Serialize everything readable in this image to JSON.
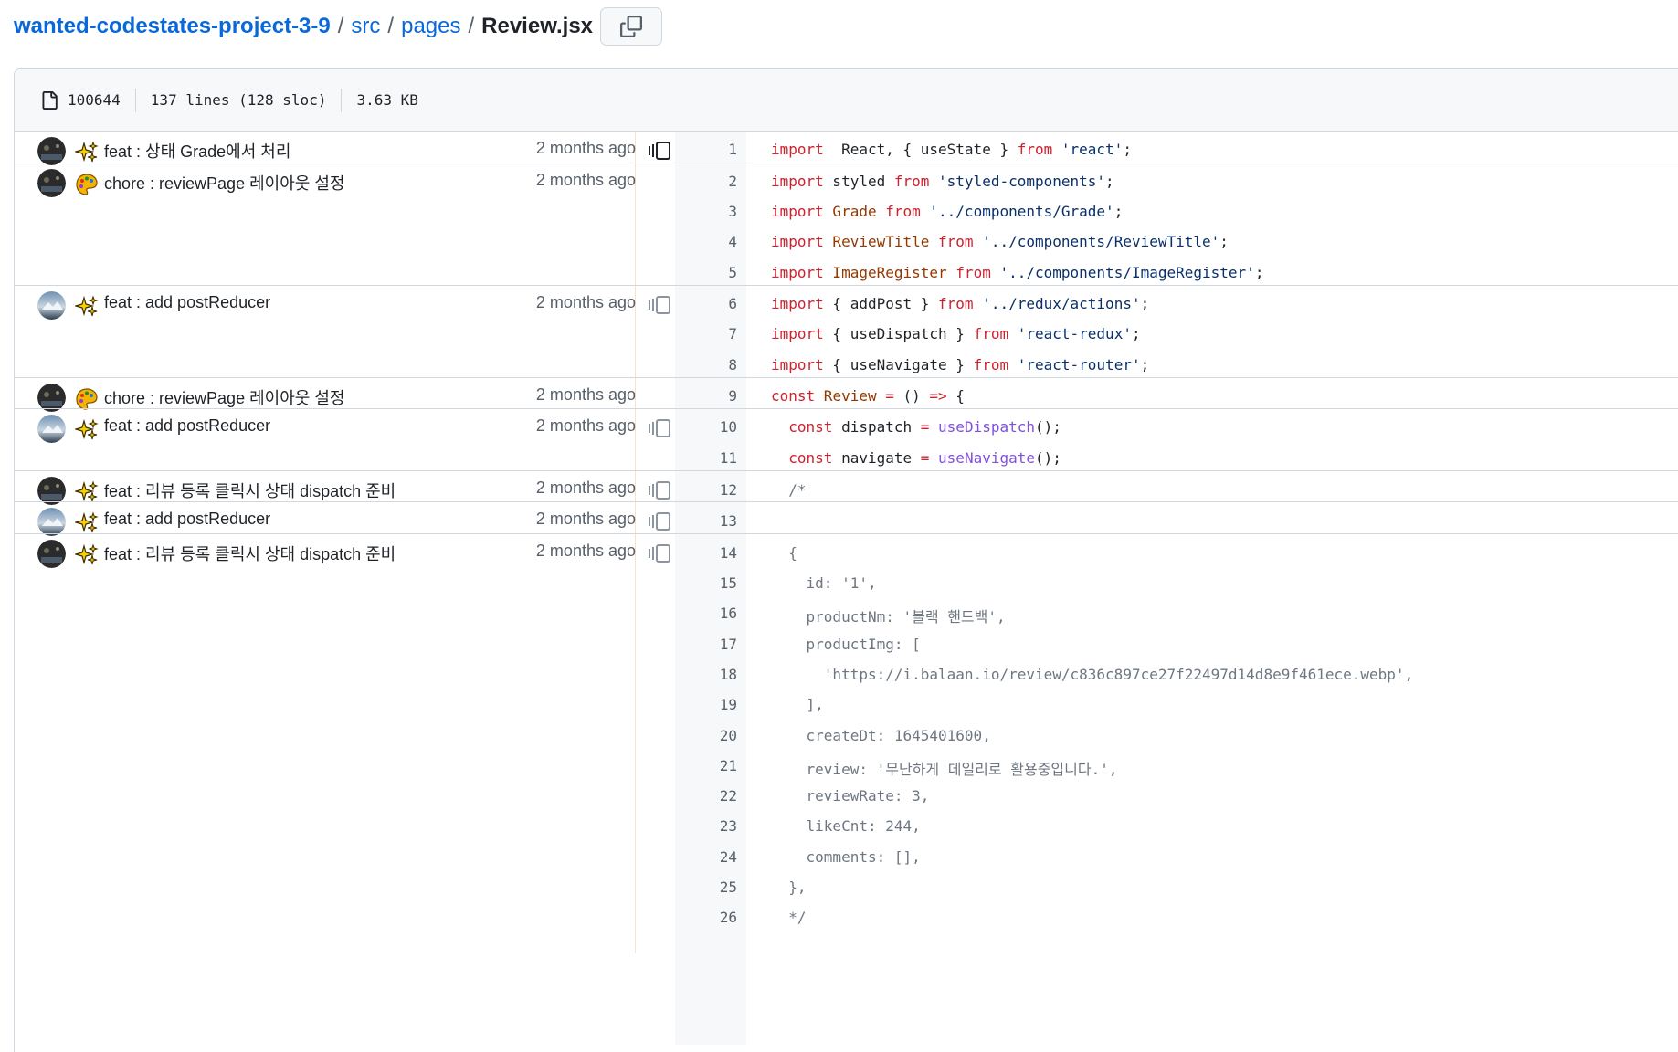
{
  "breadcrumb": {
    "repo": "wanted-codestates-project-3-9",
    "dir1": "src",
    "dir2": "pages",
    "file": "Review.jsx",
    "sep": "/"
  },
  "file_info": {
    "mode": "100644",
    "lines": "137 lines (128 sloc)",
    "size": "3.63 KB"
  },
  "hunks": [
    {
      "message": "feat : 상태 Grade에서 처리",
      "time": "2 months ago",
      "emoji": "sparkle-icon"
    },
    {
      "message": "chore : reviewPage 레이아웃 설정",
      "time": "2 months ago",
      "emoji": "palette-icon"
    },
    {
      "message": "feat : add postReducer",
      "time": "2 months ago",
      "emoji": "sparkle-icon"
    },
    {
      "message": "chore : reviewPage 레이아웃 설정",
      "time": "2 months ago",
      "emoji": "palette-icon"
    },
    {
      "message": "feat : add postReducer",
      "time": "2 months ago",
      "emoji": "sparkle-icon"
    },
    {
      "message": "feat : 리뷰 등록 클릭시 상태 dispatch 준비",
      "time": "2 months ago",
      "emoji": "sparkle-icon"
    },
    {
      "message": "feat : add postReducer",
      "time": "2 months ago",
      "emoji": "sparkle-icon"
    },
    {
      "message": "feat : 리뷰 등록 클릭시 상태 dispatch 준비",
      "time": "2 months ago",
      "emoji": "sparkle-icon"
    }
  ],
  "lines": [
    {
      "n": "1",
      "t": [
        [
          "kw",
          "import"
        ],
        [
          "",
          "  React, { useState } "
        ],
        [
          "kw",
          "from"
        ],
        [
          "st",
          " 'react'"
        ],
        [
          "",
          ";"
        ]
      ]
    },
    {
      "n": "2",
      "t": [
        [
          "kw",
          "import"
        ],
        [
          "",
          " styled "
        ],
        [
          "kw",
          "from"
        ],
        [
          "st",
          " 'styled-components'"
        ],
        [
          "",
          ";"
        ]
      ]
    },
    {
      "n": "3",
      "t": [
        [
          "kw",
          "import"
        ],
        [
          "en",
          " Grade "
        ],
        [
          "kw",
          "from"
        ],
        [
          "st",
          " '../components/Grade'"
        ],
        [
          "",
          ";"
        ]
      ]
    },
    {
      "n": "4",
      "t": [
        [
          "kw",
          "import"
        ],
        [
          "en",
          " ReviewTitle "
        ],
        [
          "kw",
          "from"
        ],
        [
          "st",
          " '../components/ReviewTitle'"
        ],
        [
          "",
          ";"
        ]
      ]
    },
    {
      "n": "5",
      "t": [
        [
          "kw",
          "import"
        ],
        [
          "en",
          " ImageRegister "
        ],
        [
          "kw",
          "from"
        ],
        [
          "st",
          " '../components/ImageRegister'"
        ],
        [
          "",
          ";"
        ]
      ]
    },
    {
      "n": "6",
      "t": [
        [
          "kw",
          "import"
        ],
        [
          "",
          " { addPost } "
        ],
        [
          "kw",
          "from"
        ],
        [
          "st",
          " '../redux/actions'"
        ],
        [
          "",
          ";"
        ]
      ]
    },
    {
      "n": "7",
      "t": [
        [
          "kw",
          "import"
        ],
        [
          "",
          " { useDispatch } "
        ],
        [
          "kw",
          "from"
        ],
        [
          "st",
          " 'react-redux'"
        ],
        [
          "",
          ";"
        ]
      ]
    },
    {
      "n": "8",
      "t": [
        [
          "kw",
          "import"
        ],
        [
          "",
          " { useNavigate } "
        ],
        [
          "kw",
          "from"
        ],
        [
          "st",
          " 'react-router'"
        ],
        [
          "",
          ";"
        ]
      ]
    },
    {
      "n": "9",
      "t": [
        [
          "kw",
          "const"
        ],
        [
          "en",
          " Review "
        ],
        [
          "kw",
          "="
        ],
        [
          "",
          " () "
        ],
        [
          "kw",
          "=>"
        ],
        [
          "",
          " {"
        ]
      ]
    },
    {
      "n": "10",
      "t": [
        [
          "",
          "  "
        ],
        [
          "kw",
          "const"
        ],
        [
          "",
          " dispatch "
        ],
        [
          "kw",
          "="
        ],
        [
          "fn",
          " useDispatch"
        ],
        [
          "",
          "();"
        ]
      ]
    },
    {
      "n": "11",
      "t": [
        [
          "",
          "  "
        ],
        [
          "kw",
          "const"
        ],
        [
          "",
          " navigate "
        ],
        [
          "kw",
          "="
        ],
        [
          "fn",
          " useNavigate"
        ],
        [
          "",
          "();"
        ]
      ]
    },
    {
      "n": "12",
      "t": [
        [
          "cm",
          "  /*"
        ]
      ]
    },
    {
      "n": "13",
      "t": [
        [
          "",
          ""
        ]
      ]
    },
    {
      "n": "14",
      "t": [
        [
          "cm",
          "  {"
        ]
      ]
    },
    {
      "n": "15",
      "t": [
        [
          "cm",
          "    id: '1',"
        ]
      ]
    },
    {
      "n": "16",
      "t": [
        [
          "cm",
          "    productNm: '블랙 핸드백',"
        ]
      ]
    },
    {
      "n": "17",
      "t": [
        [
          "cm",
          "    productImg: ["
        ]
      ]
    },
    {
      "n": "18",
      "t": [
        [
          "cm",
          "      'https://i.balaan.io/review/c836c897ce27f22497d14d8e9f461ece.webp',"
        ]
      ]
    },
    {
      "n": "19",
      "t": [
        [
          "cm",
          "    ],"
        ]
      ]
    },
    {
      "n": "20",
      "t": [
        [
          "cm",
          "    createDt: 1645401600,"
        ]
      ]
    },
    {
      "n": "21",
      "t": [
        [
          "cm",
          "    review: '무난하게 데일리로 활용중입니다.',"
        ]
      ]
    },
    {
      "n": "22",
      "t": [
        [
          "cm",
          "    reviewRate: 3,"
        ]
      ]
    },
    {
      "n": "23",
      "t": [
        [
          "cm",
          "    likeCnt: 244,"
        ]
      ]
    },
    {
      "n": "24",
      "t": [
        [
          "cm",
          "    comments: [],"
        ]
      ]
    },
    {
      "n": "25",
      "t": [
        [
          "cm",
          "  },"
        ]
      ]
    },
    {
      "n": "26",
      "t": [
        [
          "cm",
          "  */"
        ]
      ]
    }
  ]
}
